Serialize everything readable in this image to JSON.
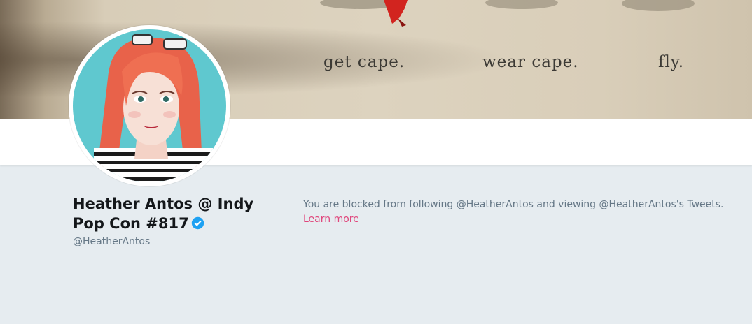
{
  "banner": {
    "captions": [
      "get cape.",
      "wear cape.",
      "fly."
    ]
  },
  "profile": {
    "display_name": "Heather Antos @ Indy Pop Con #817",
    "handle": "@HeatherAntos",
    "verified": true
  },
  "blocked_notice": {
    "message": "You are blocked from following @HeatherAntos and viewing @HeatherAntos's Tweets.",
    "link_label": "Learn more"
  },
  "colors": {
    "link": "#e0457b",
    "verified": "#1da1f2",
    "page_bg": "#e6ecf0",
    "muted_text": "#657786",
    "avatar_bg": "#5fc8cf",
    "hair": "#e8624a"
  },
  "icons": {
    "verified": "verified-badge-icon"
  }
}
